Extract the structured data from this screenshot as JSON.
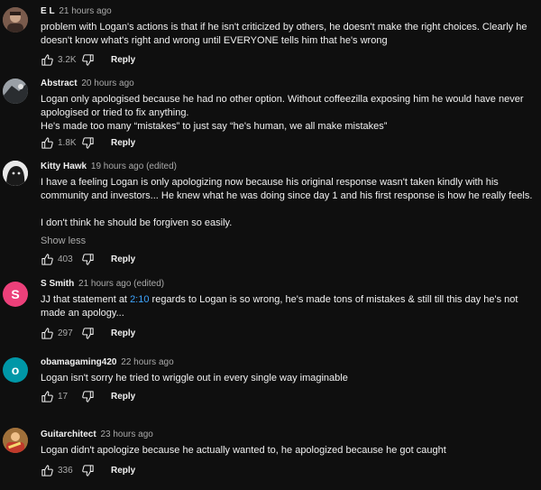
{
  "comments": [
    {
      "author": "E L",
      "time": "21 hours ago",
      "text": "problem with Logan's actions is that if he isn't criticized by others, he doesn't make the right choices. Clearly he doesn't know what's right and wrong until EVERYONE tells him that he's wrong",
      "likes": "3.2K",
      "reply": "Reply",
      "avatar": "photo-avatar"
    },
    {
      "author": "Abstract",
      "time": "20 hours ago",
      "text_1": "Logan only apologised because he had no other option. Without coffeezilla exposing him he would have never apologised or tried to fix anything.",
      "text_2": "He's made too many “mistakes” to just say “he's human, we all make mistakes”",
      "likes": "1.8K",
      "reply": "Reply",
      "avatar": "photo-avatar"
    },
    {
      "author": "Kitty Hawk",
      "time": "19 hours ago (edited)",
      "text_1": "I have a feeling Logan is only apologizing now because his original response wasn't taken kindly with his community and investors... He knew what he was doing since day 1 and his first response is how he really feels.",
      "text_2": "I don't think he should be forgiven so easily.",
      "show_less": "Show less",
      "likes": "403",
      "reply": "Reply",
      "avatar": "photo-avatar"
    },
    {
      "author": "S Smith",
      "time": "21 hours ago (edited)",
      "text_before": "JJ that statement at ",
      "timestamp": "2:10",
      "text_after": " regards to Logan is so wrong, he's made tons of mistakes & still till this day he's not made an apology...",
      "likes": "297",
      "reply": "Reply",
      "avatar_letter": "S",
      "avatar_color": "#ec407a"
    },
    {
      "author": "obamagaming420",
      "time": "22 hours ago",
      "text": "Logan isn't sorry he tried to wriggle out in every single way imaginable",
      "likes": "17",
      "reply": "Reply",
      "avatar_letter": "o",
      "avatar_color": "#0097a7"
    },
    {
      "author": "Guitarchitect",
      "time": "23 hours ago",
      "text": "Logan didn't apologize because he actually wanted to, he apologized because he got caught",
      "likes": "336",
      "reply": "Reply",
      "avatar": "photo-avatar"
    }
  ]
}
